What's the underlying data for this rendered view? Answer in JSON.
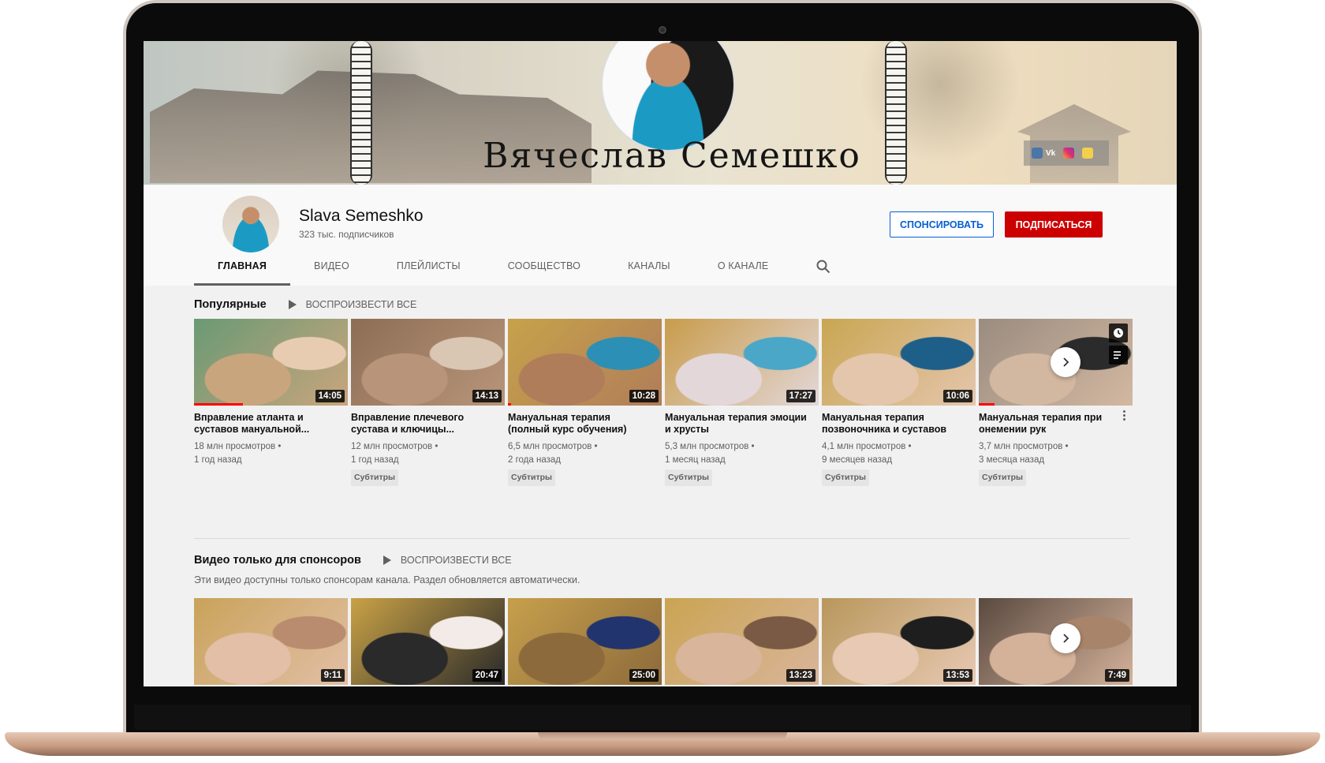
{
  "banner": {
    "title": "Вячеслав Семешко",
    "social_links": [
      {
        "icon": "vk-icon",
        "label": "Vk"
      },
      {
        "icon": "instagram-icon",
        "label": ""
      },
      {
        "icon": "odnoklassniki-icon",
        "label": ""
      }
    ]
  },
  "channel": {
    "name": "Slava Semeshko",
    "subscribers": "323 тыс. подписчиков",
    "sponsor_label": "СПОНСИРОВАТЬ",
    "subscribe_label": "ПОДПИСАТЬСЯ"
  },
  "tabs": [
    {
      "label": "ГЛАВНАЯ",
      "active": true
    },
    {
      "label": "ВИДЕО"
    },
    {
      "label": "ПЛЕЙЛИСТЫ"
    },
    {
      "label": "СООБЩЕСТВО"
    },
    {
      "label": "КАНАЛЫ"
    },
    {
      "label": "О КАНАЛЕ"
    }
  ],
  "popular": {
    "title": "Популярные",
    "play_all": "ВОСПРОИЗВЕСТИ ВСЕ",
    "videos": [
      {
        "title": "Вправление атланта и суставов мануальной...",
        "duration": "14:05",
        "views": "18 млн просмотров •",
        "age": "1 год назад",
        "badge": "",
        "progress": 0.32,
        "colors": [
          "#6a9a74",
          "#c9a57d",
          "#e8ccb2"
        ]
      },
      {
        "title": "Вправление плечевого сустава и ключицы...",
        "duration": "14:13",
        "views": "12 млн просмотров •",
        "age": "1 год назад",
        "badge": "Субтитры",
        "progress": 0,
        "colors": [
          "#8d6e55",
          "#b8957a",
          "#d9c7b4"
        ]
      },
      {
        "title": "Мануальная терапия (полный курс обучения)",
        "duration": "10:28",
        "views": "6,5 млн просмотров •",
        "age": "2 года назад",
        "badge": "Субтитры",
        "progress": 0.02,
        "colors": [
          "#c7a24a",
          "#b07d5a",
          "#2c8fb5"
        ]
      },
      {
        "title": "Мануальная терапия эмоции и хрусты",
        "duration": "17:27",
        "views": "5,3 млн просмотров •",
        "age": "1 месяц назад",
        "badge": "Субтитры",
        "progress": 0,
        "colors": [
          "#c89c4b",
          "#e3d7d9",
          "#4aa7c8"
        ]
      },
      {
        "title": "Мануальная терапия позвоночника и суставов",
        "duration": "10:06",
        "views": "4,1 млн просмотров •",
        "age": "9 месяцев назад",
        "badge": "Субтитры",
        "progress": 0,
        "colors": [
          "#c9a652",
          "#e4c6ad",
          "#1e5f8a"
        ]
      },
      {
        "title": "Мануальная терапия при онемении рук",
        "duration": "",
        "views": "3,7 млн просмотров •",
        "age": "3 месяца назад",
        "badge": "Субтитры",
        "progress": 0.1,
        "colors": [
          "#9a8c80",
          "#d3b8a1",
          "#2b2b2b"
        ]
      }
    ]
  },
  "sponsors": {
    "title": "Видео только для спонсоров",
    "play_all": "ВОСПРОИЗВЕСТИ ВСЕ",
    "description": "Эти видео доступны только спонсорам канала. Раздел обновляется автоматически.",
    "videos": [
      {
        "duration": "9:11",
        "colors": [
          "#c9a35a",
          "#e2bfa6",
          "#b98c6f"
        ]
      },
      {
        "duration": "20:47",
        "colors": [
          "#c9a246",
          "#2a2a2a",
          "#f2ebe7"
        ]
      },
      {
        "duration": "25:00",
        "colors": [
          "#c7a04c",
          "#8c6a3b",
          "#22346e"
        ]
      },
      {
        "duration": "13:23",
        "colors": [
          "#caa452",
          "#d9b59b",
          "#7a5a44"
        ]
      },
      {
        "duration": "13:53",
        "colors": [
          "#b8975c",
          "#e8c9b3",
          "#1e1e1e"
        ]
      },
      {
        "duration": "7:49",
        "colors": [
          "#5a4a40",
          "#d4b29a",
          "#a8846a"
        ]
      }
    ]
  }
}
